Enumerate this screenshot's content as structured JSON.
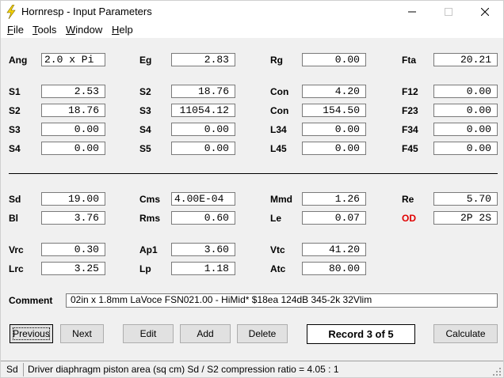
{
  "window": {
    "title": "Hornresp - Input Parameters"
  },
  "menu": [
    "File",
    "Tools",
    "Window",
    "Help"
  ],
  "rows": [
    [
      {
        "label": "Ang",
        "value": "2.0 x Pi",
        "align": "left"
      },
      {
        "label": "Eg",
        "value": "2.83"
      },
      {
        "label": "Rg",
        "value": "0.00"
      },
      {
        "label": "Fta",
        "value": "20.21"
      }
    ],
    [
      {
        "label": "S1",
        "value": "2.53"
      },
      {
        "label": "S2",
        "value": "18.76"
      },
      {
        "label": "Con",
        "value": "4.20"
      },
      {
        "label": "F12",
        "value": "0.00"
      }
    ],
    [
      {
        "label": "S2",
        "value": "18.76"
      },
      {
        "label": "S3",
        "value": "11054.12"
      },
      {
        "label": "Con",
        "value": "154.50"
      },
      {
        "label": "F23",
        "value": "0.00"
      }
    ],
    [
      {
        "label": "S3",
        "value": "0.00"
      },
      {
        "label": "S4",
        "value": "0.00"
      },
      {
        "label": "L34",
        "value": "0.00"
      },
      {
        "label": "F34",
        "value": "0.00"
      }
    ],
    [
      {
        "label": "S4",
        "value": "0.00"
      },
      {
        "label": "S5",
        "value": "0.00"
      },
      {
        "label": "L45",
        "value": "0.00"
      },
      {
        "label": "F45",
        "value": "0.00"
      }
    ],
    [
      {
        "label": "Sd",
        "value": "19.00"
      },
      {
        "label": "Cms",
        "value": "4.00E-04",
        "align": "left"
      },
      {
        "label": "Mmd",
        "value": "1.26"
      },
      {
        "label": "Re",
        "value": "5.70"
      }
    ],
    [
      {
        "label": "Bl",
        "value": "3.76"
      },
      {
        "label": "Rms",
        "value": "0.60"
      },
      {
        "label": "Le",
        "value": "0.07"
      },
      {
        "label": "OD",
        "value": "2P 2S",
        "red": true
      }
    ],
    [
      {
        "label": "Vrc",
        "value": "0.30"
      },
      {
        "label": "Ap1",
        "value": "3.60"
      },
      {
        "label": "Vtc",
        "value": "41.20"
      }
    ],
    [
      {
        "label": "Lrc",
        "value": "3.25"
      },
      {
        "label": "Lp",
        "value": "1.18"
      },
      {
        "label": "Atc",
        "value": "80.00"
      }
    ]
  ],
  "comment": {
    "label": "Comment",
    "value": "02in x 1.8mm LaVoce FSN021.00 - HiMid* $18ea 124dB 345-2k 32Vlim"
  },
  "buttons": {
    "previous": "Previous",
    "next": "Next",
    "edit": "Edit",
    "add": "Add",
    "delete": "Delete",
    "calculate": "Calculate"
  },
  "record_label": "Record 3 of 5",
  "status": {
    "field": "Sd",
    "description": "Driver diaphragm piston area  (sq cm)   Sd / S2 compression ratio = 4.05 : 1"
  },
  "colors": {
    "accent_red": "#e00000",
    "window_bg": "#f0f0f0",
    "icon_yellow": "#f5d300"
  }
}
